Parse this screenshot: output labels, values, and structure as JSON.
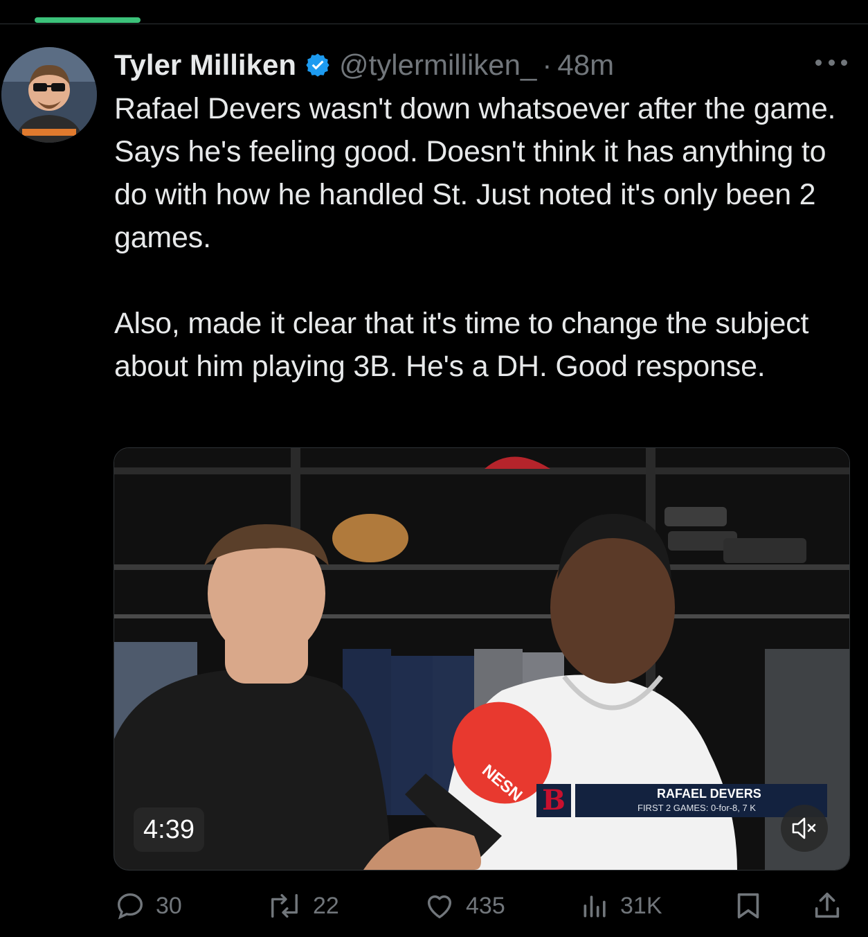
{
  "tweet": {
    "author_name": "Tyler Milliken",
    "handle": "@tylermilliken_",
    "separator": "·",
    "time": "48m",
    "text": "Rafael Devers wasn't down whatsoever after the game. Says he's feeling good. Doesn't think it has anything to do with how he handled St. Just noted it's only been 2 games.\n\nAlso, made it clear that it's time to change the subject about him playing 3B. He's a DH. Good response."
  },
  "video": {
    "duration": "4:39",
    "mic_flag": "NESN",
    "lower_third": {
      "logo": "B",
      "name": "RAFAEL DEVERS",
      "subtitle": "FIRST 2 GAMES: 0-for-8, 7 K"
    }
  },
  "actions": {
    "replies": "30",
    "reposts": "22",
    "likes": "435",
    "views": "31K"
  },
  "colors": {
    "background": "#000000",
    "text_primary": "#e7e9ea",
    "text_secondary": "#71767b",
    "verified": "#1d9bf0",
    "progress": "#3cc27a"
  },
  "icons": [
    "verified-badge-icon",
    "more-icon",
    "reply-icon",
    "repost-icon",
    "like-icon",
    "views-icon",
    "bookmark-icon",
    "share-icon",
    "mute-icon"
  ]
}
